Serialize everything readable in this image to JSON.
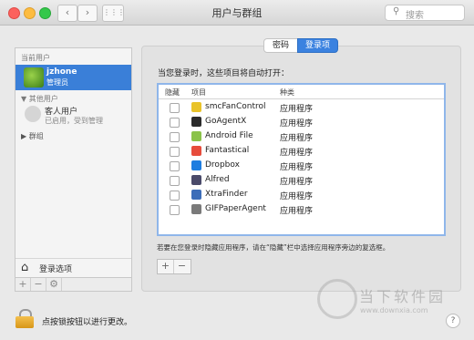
{
  "window": {
    "title": "用户与群组"
  },
  "toolbar": {
    "back_icon": "‹",
    "forward_icon": "›",
    "grid_icon": "⋮⋮⋮",
    "search_placeholder": "搜索"
  },
  "sidebar": {
    "current_user_header": "当前用户",
    "current_user_name": "jzhone",
    "current_user_role": "管理员",
    "other_users_header": "其他用户",
    "guest_name": "客人用户",
    "guest_status": "已启用，受到管理",
    "groups_label": "群组",
    "login_options_label": "登录选项",
    "bottom_buttons": [
      "+",
      "−",
      "⚙"
    ]
  },
  "tabs": [
    {
      "label": "密码"
    },
    {
      "label": "登录项"
    }
  ],
  "main": {
    "items_label": "当您登录时，这些项目将自动打开：",
    "table_headers": {
      "hide": "隐藏",
      "item": "项目",
      "kind": "种类"
    },
    "rows": [
      {
        "name": "smcFanControl",
        "kind": "应用程序",
        "icon_color": "#e9c32a"
      },
      {
        "name": "GoAgentX",
        "kind": "应用程序",
        "icon_color": "#2b2b2b"
      },
      {
        "name": "Android File",
        "kind": "应用程序",
        "icon_color": "#8bc34a"
      },
      {
        "name": "Fantastical",
        "kind": "应用程序",
        "icon_color": "#e74c3c"
      },
      {
        "name": "Dropbox",
        "kind": "应用程序",
        "icon_color": "#1e7de0"
      },
      {
        "name": "Alfred",
        "kind": "应用程序",
        "icon_color": "#4a4a6a"
      },
      {
        "name": "XtraFinder",
        "kind": "应用程序",
        "icon_color": "#3c6db8"
      },
      {
        "name": "GIFPaperAgent",
        "kind": "应用程序",
        "icon_color": "#7a7a7a"
      }
    ],
    "hint": "若要在您登录时隐藏应用程序，请在“隐藏”栏中选择应用程序旁边的复选框。",
    "add_label": "+",
    "remove_label": "−"
  },
  "footer": {
    "lock_text": "点按锁按钮以进行更改。",
    "help_label": "?"
  },
  "watermark": {
    "text": "当下软件园",
    "url": "www.downxia.com"
  }
}
